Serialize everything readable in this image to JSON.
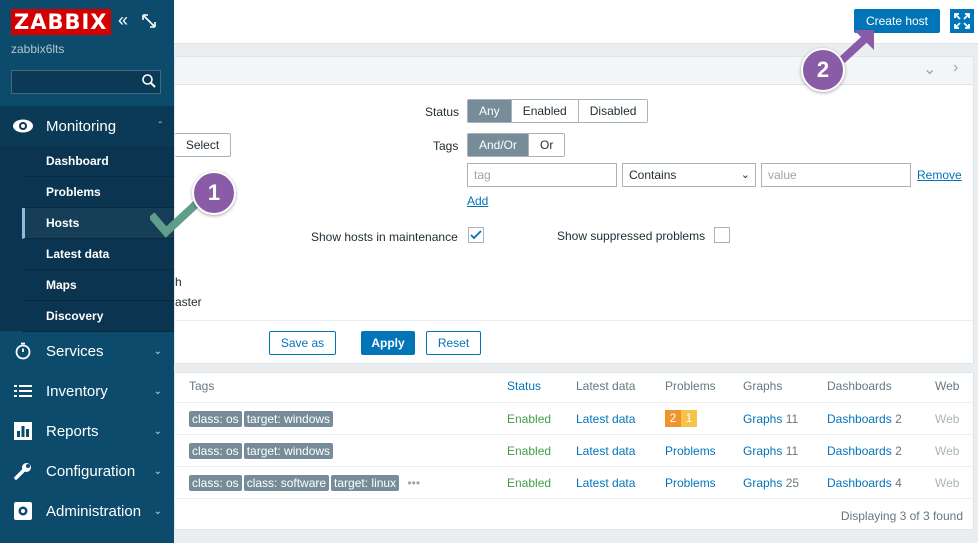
{
  "sidebar": {
    "logo": "ZABBIX",
    "server": "zabbix6lts",
    "search_placeholder": "",
    "menu": [
      {
        "label": "Monitoring",
        "icon": "eye-icon"
      },
      {
        "label": "Services",
        "icon": "stopwatch-icon"
      },
      {
        "label": "Inventory",
        "icon": "list-icon"
      },
      {
        "label": "Reports",
        "icon": "bar-chart-icon"
      },
      {
        "label": "Configuration",
        "icon": "wrench-icon"
      },
      {
        "label": "Administration",
        "icon": "gear-icon"
      }
    ],
    "submenu": [
      "Dashboard",
      "Problems",
      "Hosts",
      "Latest data",
      "Maps",
      "Discovery"
    ]
  },
  "header": {
    "create_host": "Create host"
  },
  "filter": {
    "select_label": "Select",
    "status_label": "Status",
    "status_options": [
      "Any",
      "Enabled",
      "Disabled"
    ],
    "tags_label": "Tags",
    "tags_options": [
      "And/Or",
      "Or"
    ],
    "tag_placeholder": "tag",
    "operator_value": "Contains",
    "value_placeholder": "value",
    "remove_link": "Remove",
    "add_link": "Add",
    "maintenance_label": "Show hosts in maintenance",
    "suppressed_label": "Show suppressed problems",
    "partial_text_1": "h",
    "partial_text_2": "aster",
    "save_as": "Save as",
    "apply": "Apply",
    "reset": "Reset"
  },
  "table": {
    "headers": [
      "Tags",
      "Status",
      "Latest data",
      "Problems",
      "Graphs",
      "Dashboards",
      "Web"
    ],
    "rows": [
      {
        "tags": [
          "class: os",
          "target: windows"
        ],
        "status": "Enabled",
        "latest": "Latest data",
        "problems_badges": [
          "2",
          "1"
        ],
        "graphs": "Graphs",
        "graphs_count": "11",
        "dashboards": "Dashboards",
        "dashboards_count": "2",
        "web": "Web"
      },
      {
        "tags": [
          "class: os",
          "target: windows"
        ],
        "status": "Enabled",
        "latest": "Latest data",
        "problems": "Problems",
        "graphs": "Graphs",
        "graphs_count": "11",
        "dashboards": "Dashboards",
        "dashboards_count": "2",
        "web": "Web"
      },
      {
        "tags": [
          "class: os",
          "class: software",
          "target: linux"
        ],
        "more": "•••",
        "status": "Enabled",
        "latest": "Latest data",
        "problems": "Problems",
        "graphs": "Graphs",
        "graphs_count": "25",
        "dashboards": "Dashboards",
        "dashboards_count": "4",
        "web": "Web"
      }
    ],
    "footer": "Displaying 3 of 3 found"
  },
  "annotations": [
    "1",
    "2"
  ],
  "colors": {
    "accent": "#0275b8",
    "sidebar": "#0d4b6d",
    "annotation": "#8a5ca8",
    "check": "#5e9e8a",
    "enabled": "#429e47",
    "badge_high": "#f0932e",
    "badge_avg": "#f5c34a"
  }
}
